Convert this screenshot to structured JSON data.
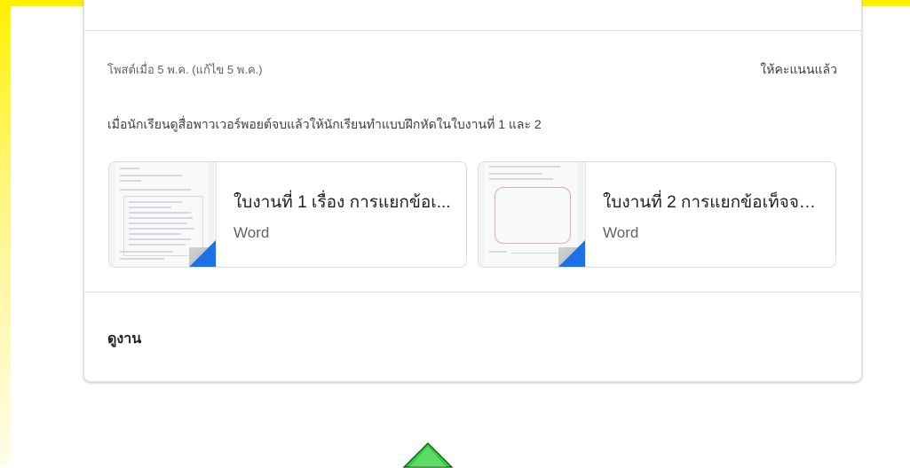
{
  "post": {
    "meta": "โพสต์เมื่อ 5 พ.ค. (แก้ไข 5 พ.ค.)",
    "grade_status": "ให้คะแนนแล้ว",
    "instructions": "เมื่อนักเรียนดูสื่อพาวเวอร์พอยต์จบแล้วให้นักเรียนทำแบบฝึกหัดในใบงานที่ 1 และ 2"
  },
  "attachments": [
    {
      "title": "ใบงานที่ 1 เรื่อง การแยกข้อเ...",
      "type": "Word",
      "icon": "word-doc-icon"
    },
    {
      "title": "ใบงานที่ 2 การแยกข้อเท็จจริ...",
      "type": "Word",
      "icon": "word-doc-icon"
    }
  ],
  "footer": {
    "view_work_label": "ดูงาน"
  },
  "colors": {
    "frame_yellow": "#fff200",
    "word_blue": "#1a73e8",
    "arrow_green": "#2ecc40"
  }
}
